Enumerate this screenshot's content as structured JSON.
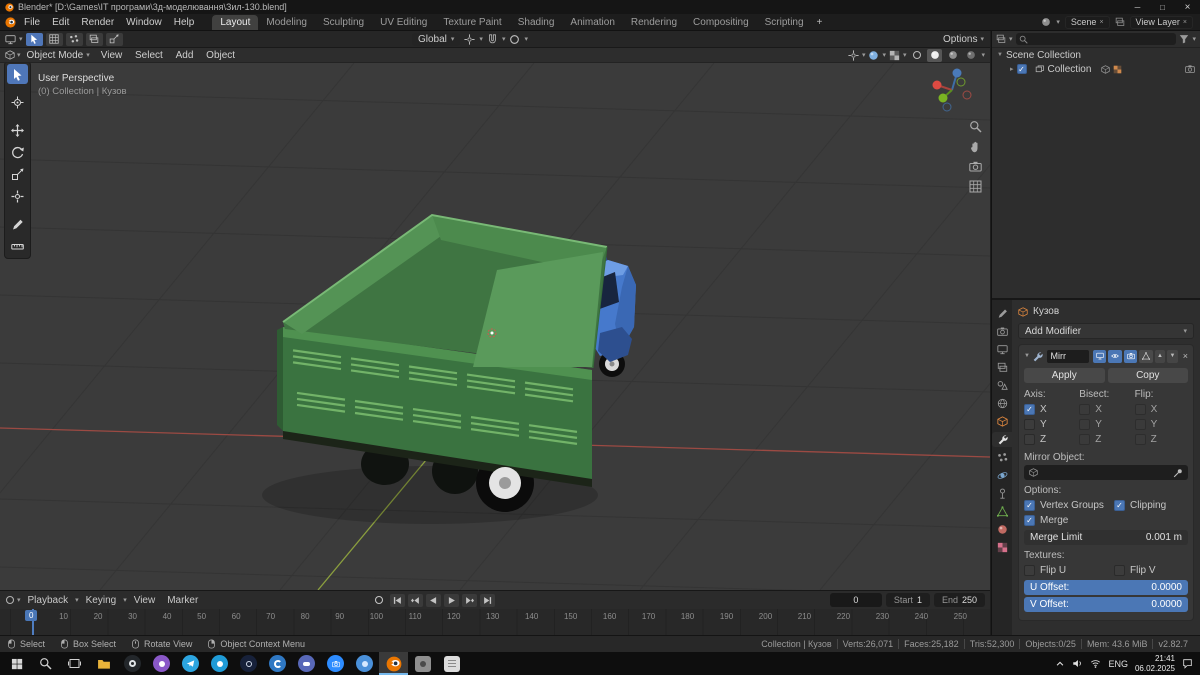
{
  "window": {
    "title": "Blender* [D:\\Games\\IT програми\\3д-моделювання\\Зил-130.blend]"
  },
  "icons": {
    "chevron_down": "▾",
    "chevron_right": "▸",
    "triangle_down": "▼",
    "check": "✓",
    "close": "×",
    "up_arrow": "▲",
    "down_arrow": "▼",
    "plus": "+",
    "minimize": "─",
    "maximize": "□"
  },
  "topbar": {
    "menus": [
      "File",
      "Edit",
      "Render",
      "Window",
      "Help"
    ],
    "workspaces": [
      "Layout",
      "Modeling",
      "Sculpting",
      "UV Editing",
      "Texture Paint",
      "Shading",
      "Animation",
      "Rendering",
      "Compositing",
      "Scripting"
    ],
    "scene_label": "Scene",
    "view_layer_label": "View Layer"
  },
  "tool_settings": {
    "orientation": "Global",
    "options": "Options"
  },
  "viewport": {
    "mode": "Object Mode",
    "menus": [
      "View",
      "Select",
      "Add",
      "Object"
    ],
    "overlay_line1": "User Perspective",
    "overlay_line2": "(0) Collection | Кузов"
  },
  "outliner": {
    "scene_collection": "Scene Collection",
    "collection": "Collection"
  },
  "properties": {
    "breadcrumb": "Кузов",
    "add_modifier": "Add Modifier",
    "modifier_name": "Mirr",
    "apply": "Apply",
    "copy": "Copy",
    "axis_label": "Axis:",
    "bisect_label": "Bisect:",
    "flip_label": "Flip:",
    "x": "X",
    "y": "Y",
    "z": "Z",
    "mirror_object_label": "Mirror Object:",
    "options_label": "Options:",
    "vertex_groups": "Vertex Groups",
    "clipping": "Clipping",
    "merge": "Merge",
    "merge_limit_label": "Merge Limit",
    "merge_limit_value": "0.001 m",
    "textures_label": "Textures:",
    "flip_u": "Flip U",
    "flip_v": "Flip V",
    "u_offset_label": "U Offset:",
    "u_offset_value": "0.0000",
    "v_offset_label": "V Offset:",
    "v_offset_value": "0.0000"
  },
  "timeline": {
    "menus": [
      "Playback",
      "Keying",
      "View",
      "Marker"
    ],
    "current_frame": "0",
    "playhead": "0",
    "start_label": "Start",
    "start_value": "1",
    "end_label": "End",
    "end_value": "250",
    "ticks": [
      "0",
      "10",
      "20",
      "30",
      "40",
      "50",
      "60",
      "70",
      "80",
      "90",
      "100",
      "110",
      "120",
      "130",
      "140",
      "150",
      "160",
      "170",
      "180",
      "190",
      "200",
      "210",
      "220",
      "230",
      "240",
      "250"
    ]
  },
  "status": {
    "hints": [
      "Select",
      "Box Select",
      "Rotate View",
      "Object Context Menu"
    ],
    "stats": [
      "Collection | Кузов",
      "Verts:26,071",
      "Faces:25,182",
      "Tris:52,300",
      "Objects:0/25",
      "Mem: 43.6 MiB",
      "v2.82.7"
    ]
  },
  "taskbar": {
    "lang": "ENG",
    "time": "21:41",
    "date": "06.02.2025"
  },
  "colors": {
    "accent": "#4772b3",
    "truck_green": "#3a7340",
    "cab_blue": "#4679cc"
  }
}
